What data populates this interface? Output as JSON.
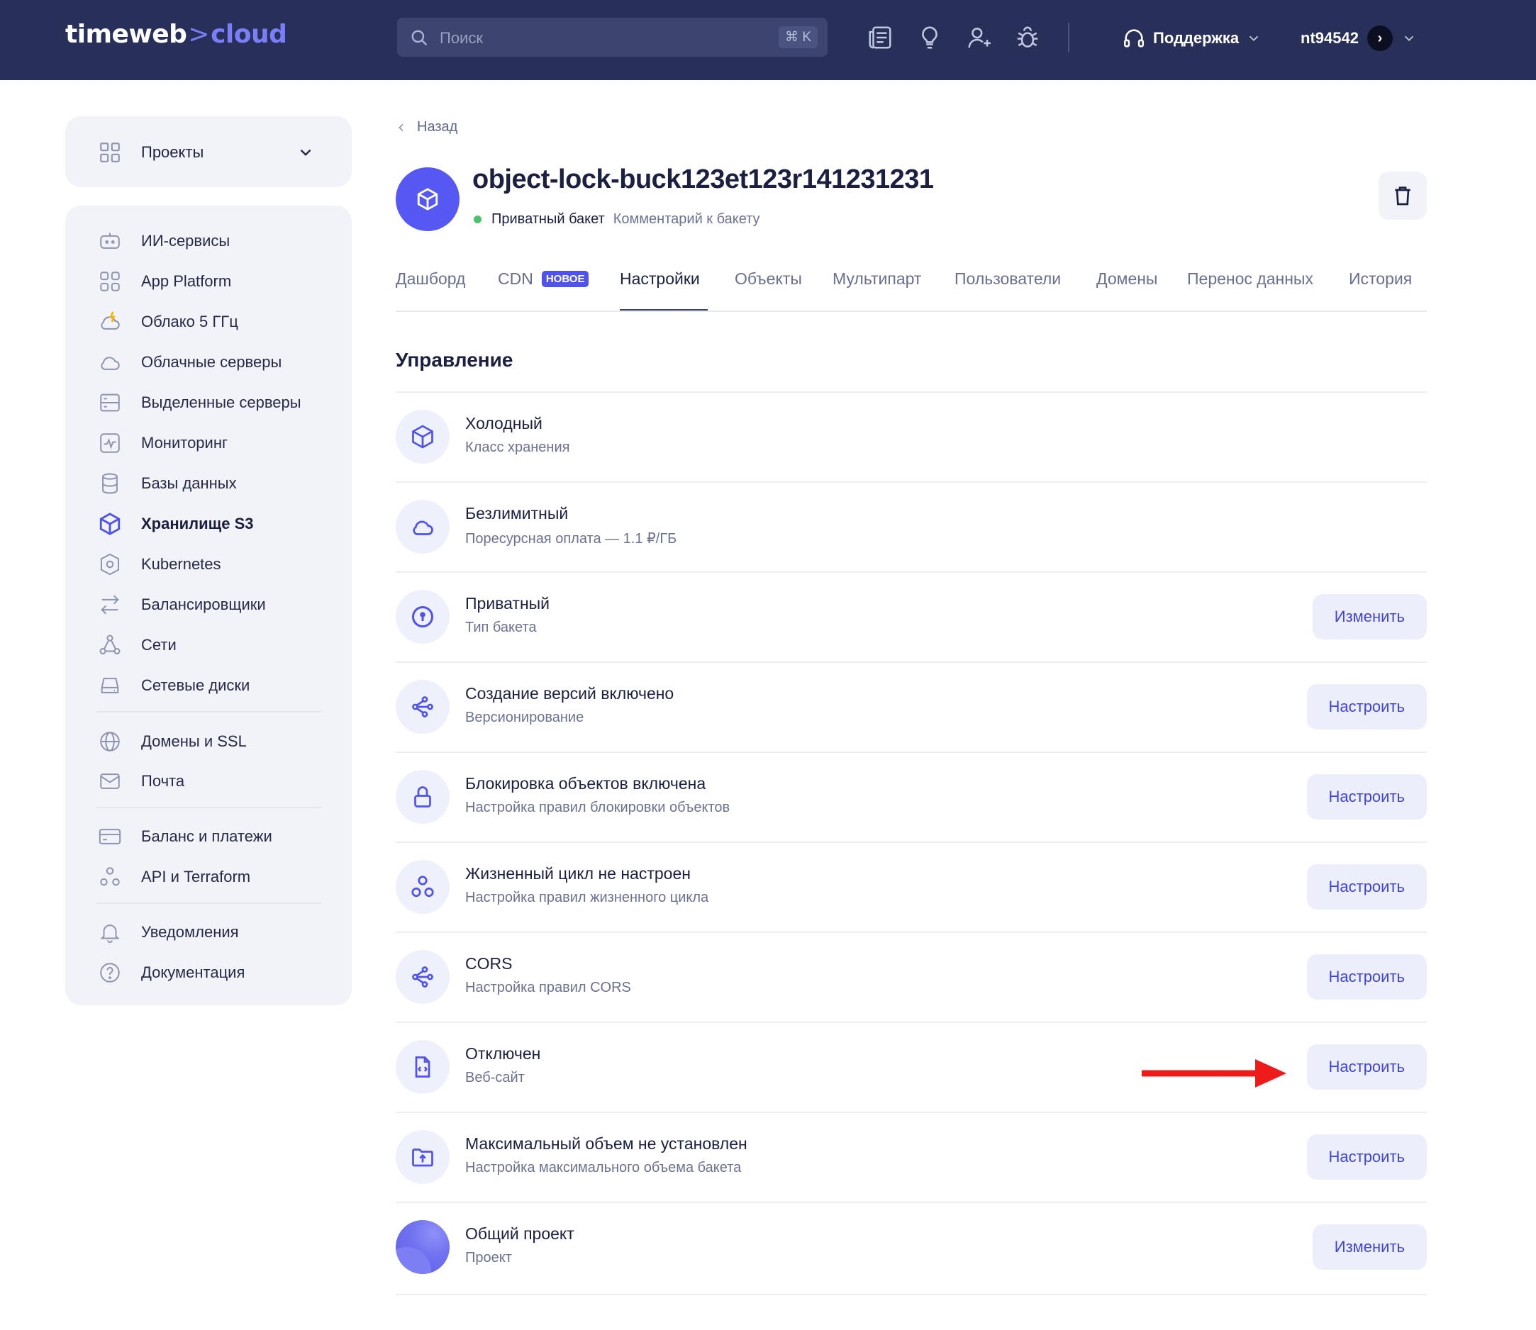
{
  "header": {
    "logo_main": "timeweb",
    "logo_arrow": ">",
    "logo_accent": "cloud",
    "search_placeholder": "Поиск",
    "search_shortcut": "⌘ K",
    "support_label": "Поддержка",
    "account_name": "nt94542",
    "icons": [
      "news-icon",
      "lightbulb-icon",
      "add-user-icon",
      "bug-icon"
    ]
  },
  "sidebar": {
    "projects_label": "Проекты",
    "items": [
      {
        "label": "ИИ-сервисы",
        "icon": "ai-bot-icon"
      },
      {
        "label": "App Platform",
        "icon": "app-grid-icon"
      },
      {
        "label": "Облако 5 ГГц",
        "icon": "cloud-bolt-icon"
      },
      {
        "label": "Облачные серверы",
        "icon": "cloud-icon"
      },
      {
        "label": "Выделенные серверы",
        "icon": "server-icon"
      },
      {
        "label": "Мониторинг",
        "icon": "monitoring-icon"
      },
      {
        "label": "Базы данных",
        "icon": "database-icon"
      },
      {
        "label": "Хранилище S3",
        "icon": "cube-icon",
        "active": true
      },
      {
        "label": "Kubernetes",
        "icon": "kubernetes-icon"
      },
      {
        "label": "Балансировщики",
        "icon": "balancer-icon"
      },
      {
        "label": "Сети",
        "icon": "network-icon"
      },
      {
        "label": "Сетевые диски",
        "icon": "disk-icon"
      },
      {
        "label": "Домены и SSL",
        "icon": "globe-icon"
      },
      {
        "label": "Почта",
        "icon": "mail-icon"
      },
      {
        "label": "Баланс и платежи",
        "icon": "card-icon"
      },
      {
        "label": "API и Terraform",
        "icon": "api-icon"
      },
      {
        "label": "Уведомления",
        "icon": "bell-icon"
      },
      {
        "label": "Документация",
        "icon": "help-icon"
      }
    ]
  },
  "main": {
    "back_label": "Назад",
    "bucket_name": "object-lock-buck123et123r141231231",
    "bucket_status": "Приватный бакет",
    "bucket_comment": "Комментарий к бакету",
    "status_color": "#4ac46b",
    "tabs": [
      {
        "label": "Дашборд"
      },
      {
        "label": "CDN",
        "badge": "НОВОЕ"
      },
      {
        "label": "Настройки",
        "active": true
      },
      {
        "label": "Объекты"
      },
      {
        "label": "Мультипарт"
      },
      {
        "label": "Пользователи"
      },
      {
        "label": "Домены"
      },
      {
        "label": "Перенос данных"
      },
      {
        "label": "История"
      }
    ],
    "section_title": "Управление",
    "settings": [
      {
        "title": "Холодный",
        "subtitle": "Класс хранения",
        "icon": "cube-icon",
        "button": null
      },
      {
        "title": "Безлимитный",
        "subtitle": "Поресурсная оплата — 1.1 ₽/ГБ",
        "icon": "cloud-icon",
        "button": null
      },
      {
        "title": "Приватный",
        "subtitle": "Тип бакета",
        "icon": "private-icon",
        "button": "Изменить"
      },
      {
        "title": "Создание версий включено",
        "subtitle": "Версионирование",
        "icon": "versions-icon",
        "button": "Настроить"
      },
      {
        "title": "Блокировка объектов включена",
        "subtitle": "Настройка правил блокировки объектов",
        "icon": "lock-icon",
        "button": "Настроить"
      },
      {
        "title": "Жизненный цикл не настроен",
        "subtitle": "Настройка правил жизненного цикла",
        "icon": "lifecycle-icon",
        "button": "Настроить"
      },
      {
        "title": "CORS",
        "subtitle": "Настройка правил CORS",
        "icon": "cors-icon",
        "button": "Настроить"
      },
      {
        "title": "Отключен",
        "subtitle": "Веб-сайт",
        "icon": "website-icon",
        "button": "Настроить"
      },
      {
        "title": "Максимальный объем не установлен",
        "subtitle": "Настройка максимального объема бакета",
        "icon": "folder-upload-icon",
        "button": "Настроить"
      },
      {
        "title": "Общий проект",
        "subtitle": "Проект",
        "icon": "project-avatar",
        "button": "Изменить"
      }
    ]
  },
  "colors": {
    "header_bg": "#28305a",
    "accent": "#5558f2",
    "button_bg": "#eceefc",
    "button_text": "#4145d6",
    "annotation_arrow": "#ee1b1b"
  }
}
